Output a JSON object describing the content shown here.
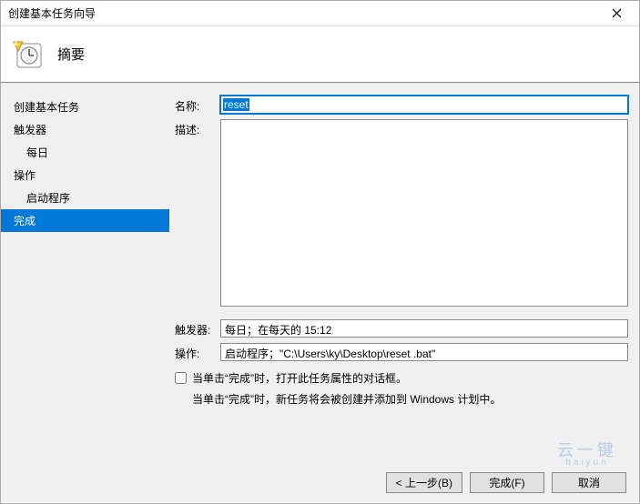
{
  "window": {
    "title": "创建基本任务向导"
  },
  "header": {
    "heading": "摘要"
  },
  "sidebar": {
    "items": [
      {
        "label": "创建基本任务",
        "sub": false,
        "selected": false
      },
      {
        "label": "触发器",
        "sub": false,
        "selected": false
      },
      {
        "label": "每日",
        "sub": true,
        "selected": false
      },
      {
        "label": "操作",
        "sub": false,
        "selected": false
      },
      {
        "label": "启动程序",
        "sub": true,
        "selected": false
      },
      {
        "label": "完成",
        "sub": false,
        "selected": true
      }
    ]
  },
  "form": {
    "name_label": "名称:",
    "name_value": "reset",
    "desc_label": "描述:",
    "desc_value": "",
    "trigger_label": "触发器:",
    "trigger_value": "每日；在每天的 15:12",
    "action_label": "操作:",
    "action_value": "启动程序；\"C:\\Users\\ky\\Desktop\\reset .bat\""
  },
  "checkbox": {
    "label": "当单击“完成”时，打开此任务属性的对话框。"
  },
  "hint": "当单击“完成”时，新任务将会被创建并添加到 Windows 计划中。",
  "buttons": {
    "back": "< 上一步(B)",
    "finish": "完成(F)",
    "cancel": "取消"
  },
  "watermark": {
    "line1": "云一键",
    "line2": "baiyun"
  }
}
